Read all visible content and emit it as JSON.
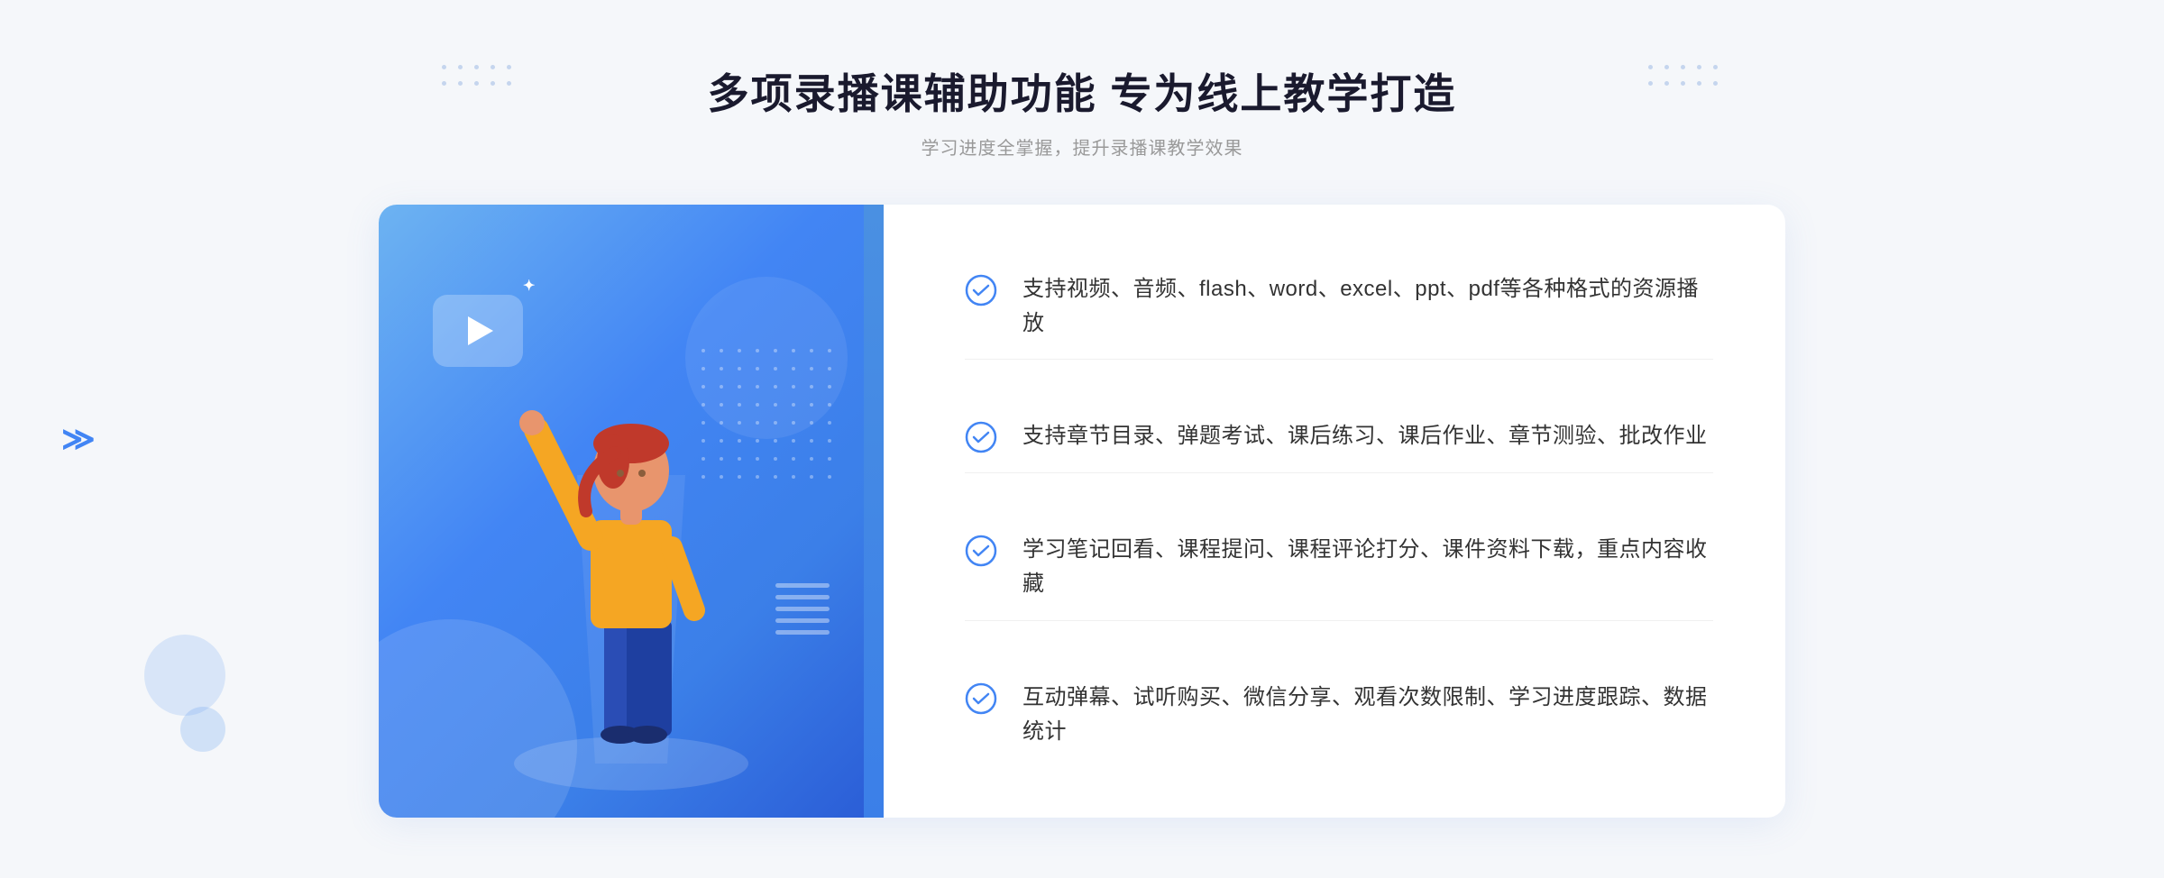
{
  "header": {
    "title": "多项录播课辅助功能 专为线上教学打造",
    "subtitle": "学习进度全掌握，提升录播课教学效果"
  },
  "features": [
    {
      "id": "feature-1",
      "text": "支持视频、音频、flash、word、excel、ppt、pdf等各种格式的资源播放"
    },
    {
      "id": "feature-2",
      "text": "支持章节目录、弹题考试、课后练习、课后作业、章节测验、批改作业"
    },
    {
      "id": "feature-3",
      "text": "学习笔记回看、课程提问、课程评论打分、课件资料下载，重点内容收藏"
    },
    {
      "id": "feature-4",
      "text": "互动弹幕、试听购买、微信分享、观看次数限制、学习进度跟踪、数据统计"
    }
  ],
  "icons": {
    "check": "✓",
    "play": "▶",
    "chevron_left": "《"
  },
  "colors": {
    "primary": "#4285f4",
    "text_main": "#1a1a2e",
    "text_sub": "#999999",
    "feature_text": "#333333",
    "check_color": "#4285f4"
  }
}
